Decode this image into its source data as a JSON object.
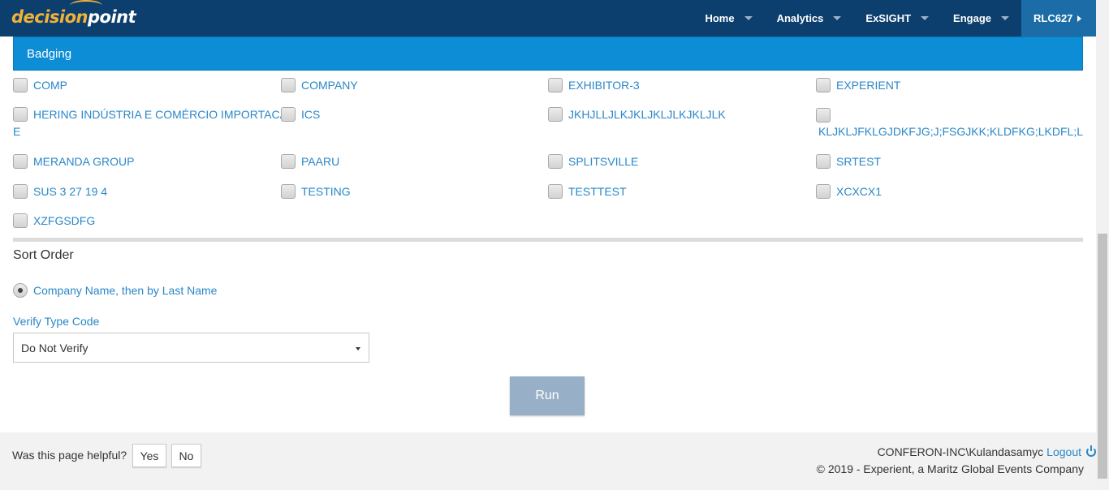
{
  "header": {
    "logo_part1": "decision",
    "logo_part2": "point",
    "nav": [
      {
        "label": "Home"
      },
      {
        "label": "Analytics"
      },
      {
        "label": "ExSIGHT"
      },
      {
        "label": "Engage"
      }
    ],
    "user": "RLC627"
  },
  "section": {
    "title": "Badging"
  },
  "companies": [
    "COMP",
    "COMPANY",
    "EXHIBITOR-3",
    "EXPERIENT",
    "HERING INDÚSTRIA E COMÉRCIO IMPORTACA",
    "ICS",
    "JKHJLLJLKJKLJKLJLKJKLJLK",
    "",
    "MERANDA GROUP",
    "PAARU",
    "SPLITSVILLE",
    "SRTEST",
    "SUS 3 27 19 4",
    "TESTING",
    "TESTTEST",
    "XCXCX1",
    "XZFGSDFG"
  ],
  "company_wraps": {
    "hering_tail": "E",
    "long_code": "KLJKLJFKLGJDKFJG;J;FSGJKK;KLDFKG;LKDFL;L"
  },
  "sort": {
    "heading": "Sort Order",
    "option": "Company Name, then by Last Name"
  },
  "verify": {
    "label": "Verify Type Code",
    "selected": "Do Not Verify"
  },
  "run_label": "Run",
  "footer": {
    "helpful": "Was this page helpful?",
    "yes": "Yes",
    "no": "No",
    "user": "CONFERON-INC\\Kulandasamyc",
    "logout": "Logout",
    "copyright": "© 2019 - Experient, a Maritz Global Events Company"
  },
  "colors": {
    "navbar": "#0d3f6e",
    "section_header": "#0d8dd6",
    "link": "#2a87c8",
    "run_button": "#97b0c8"
  }
}
